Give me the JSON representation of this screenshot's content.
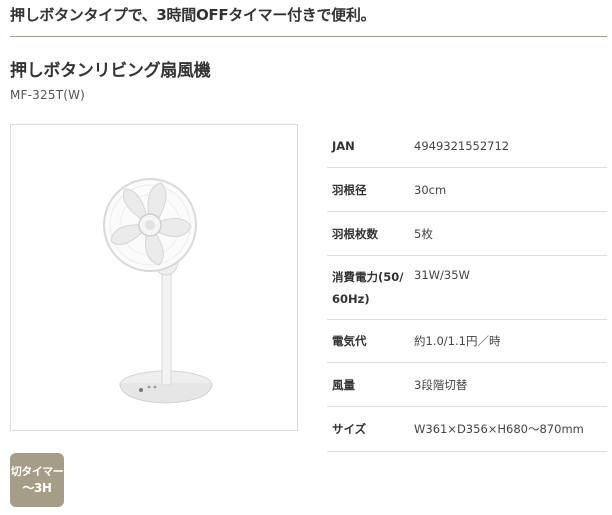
{
  "header": {
    "tagline": "押しボタンタイプで、3時間OFFタイマー付きで便利。"
  },
  "product": {
    "name": "押しボタンリビング扇風機",
    "model": "MF-325T(W)"
  },
  "specs": [
    {
      "label": "JAN",
      "value": "4949321552712"
    },
    {
      "label": "羽根径",
      "value": "30cm"
    },
    {
      "label": "羽根枚数",
      "value": "5枚"
    },
    {
      "label": "消費電力(50/60Hz)",
      "value": "31W/35W"
    },
    {
      "label": "電気代",
      "value": "約1.0/1.1円／時"
    },
    {
      "label": "風量",
      "value": "3段階切替"
    },
    {
      "label": "サイズ",
      "value": "W361×D356×H680〜870mm"
    }
  ],
  "badge": {
    "line1": "切タイマー",
    "line2": "〜3H"
  },
  "colors": {
    "accent": "#a59d87",
    "divider": "#dedede"
  }
}
